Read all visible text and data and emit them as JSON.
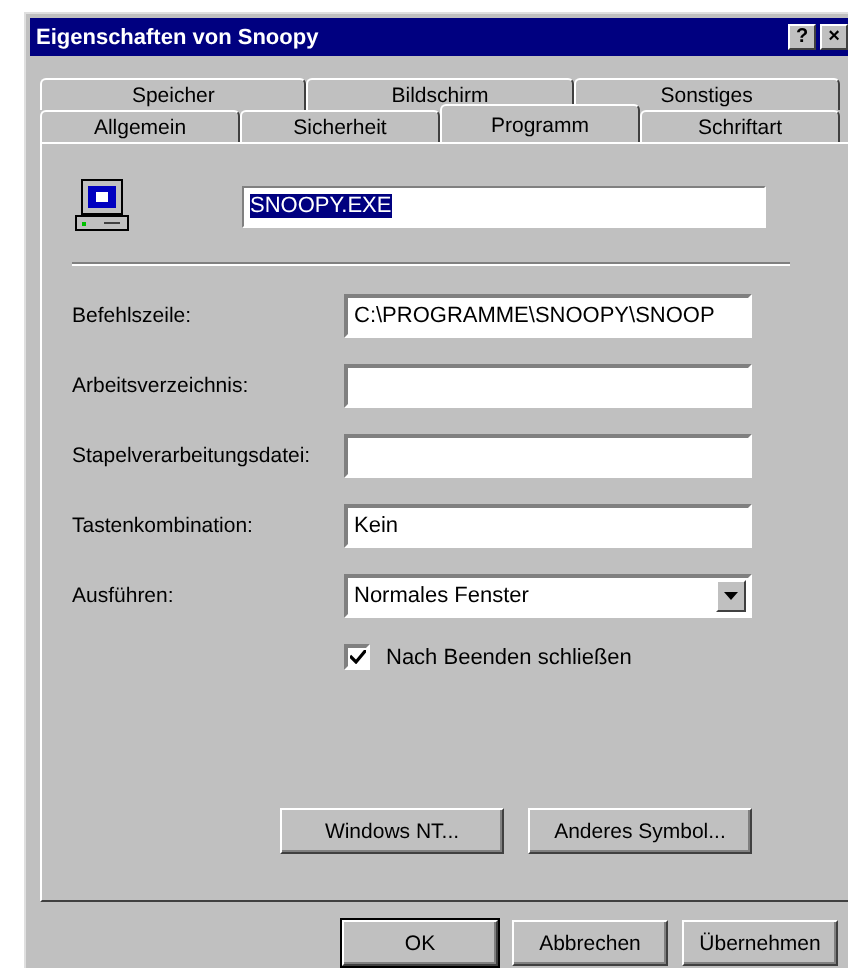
{
  "window": {
    "title": "Eigenschaften von Snoopy",
    "title_buttons": [
      "?",
      "×"
    ]
  },
  "tabs": [
    [
      {
        "label": "Speicher",
        "selected": false
      },
      {
        "label": "Bildschirm",
        "selected": false
      },
      {
        "label": "Sonstiges",
        "selected": false
      }
    ],
    [
      {
        "label": "Allgemein",
        "selected": false
      },
      {
        "label": "Sicherheit",
        "selected": false
      },
      {
        "label": "Programm",
        "selected": true
      },
      {
        "label": "Schriftart",
        "selected": false
      }
    ]
  ],
  "program_name": {
    "value": "SNOOPY.EXE",
    "selected": true
  },
  "fields": [
    {
      "kind": "text",
      "label": "Befehlszeile:",
      "value": "C:\\PROGRAMME\\SNOOPY\\SNOOP"
    },
    {
      "kind": "text",
      "label": "Arbeitsverzeichnis:"
    },
    {
      "kind": "text",
      "label": "Stapelverarbeitungsdatei:"
    },
    {
      "kind": "text",
      "label": "Tastenkombination:",
      "value": "Kein"
    },
    {
      "kind": "select",
      "label": "Ausführen:",
      "value": "Normales Fenster"
    }
  ],
  "close_on_exit": {
    "label": "Nach Beenden schließen",
    "checked": true
  },
  "panel_buttons": [
    "Windows NT...",
    "Anderes Symbol..."
  ],
  "dialog_buttons": [
    "OK",
    "Abbrechen",
    "Übernehmen"
  ]
}
